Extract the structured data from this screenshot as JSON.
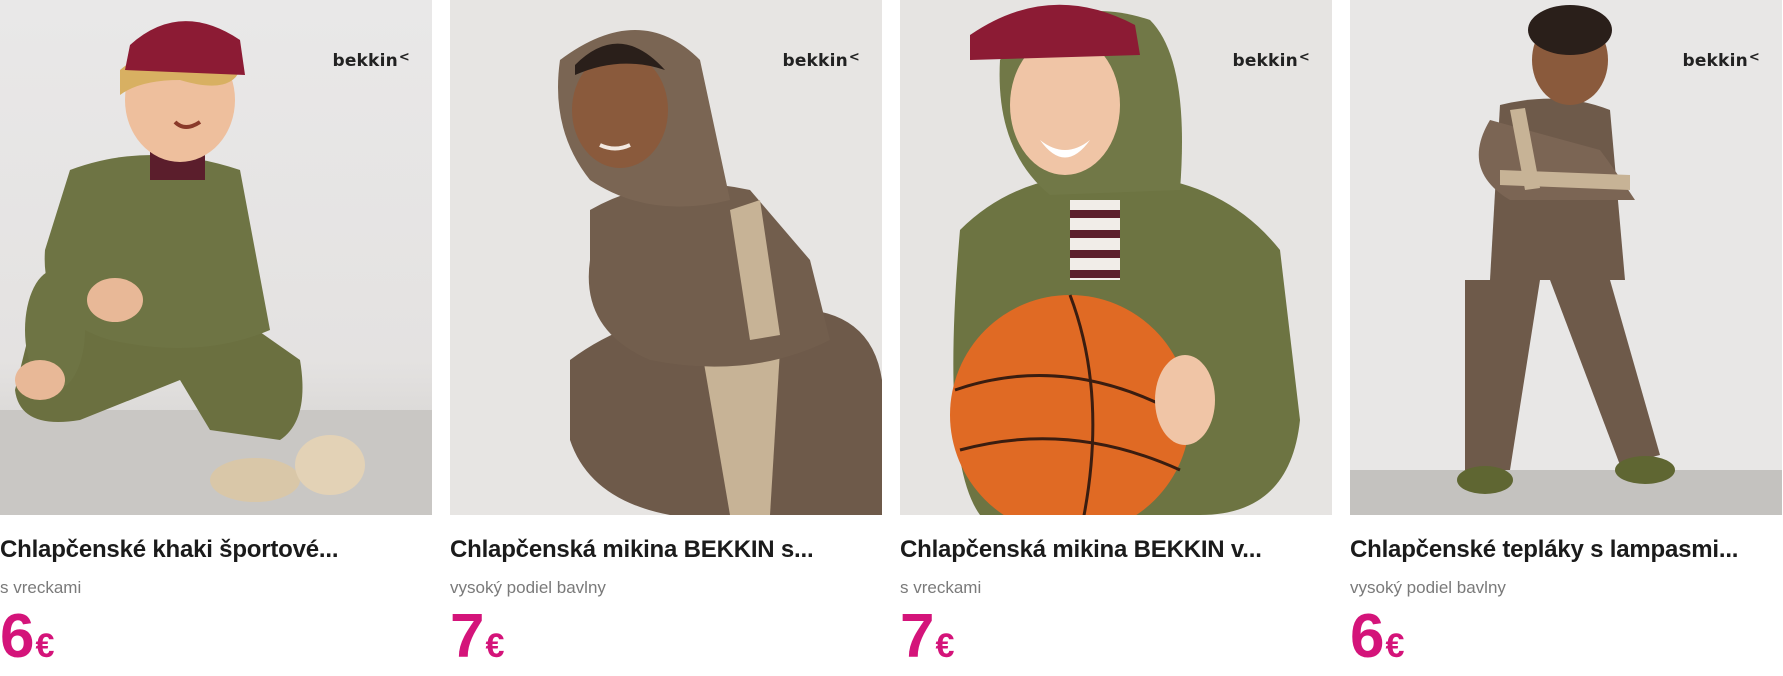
{
  "products": [
    {
      "brand": "bekkin",
      "title": "Chlapčenské khaki športové...",
      "subtitle": "s vreckami",
      "price": "6",
      "currency": "€"
    },
    {
      "brand": "bekkin",
      "title": "Chlapčenská mikina BEKKIN s...",
      "subtitle": "vysoký podiel bavlny",
      "price": "7",
      "currency": "€"
    },
    {
      "brand": "bekkin",
      "title": "Chlapčenská mikina BEKKIN v...",
      "subtitle": "s vreckami",
      "price": "7",
      "currency": "€"
    },
    {
      "brand": "bekkin",
      "title": "Chlapčenské tepláky s lampasmi...",
      "subtitle": "vysoký podiel bavlny",
      "price": "6",
      "currency": "€"
    }
  ],
  "colors": {
    "price": "#d4147a",
    "khaki": "#6b7040",
    "brown": "#6e5a4a",
    "cap": "#8c1b34",
    "ball": "#e06a24"
  }
}
